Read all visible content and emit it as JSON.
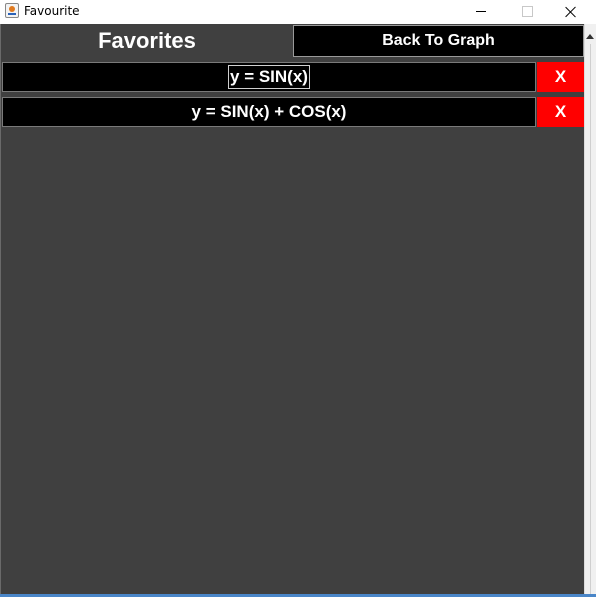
{
  "window": {
    "title": "Favourite",
    "icon": "java-icon"
  },
  "header": {
    "title": "Favorites",
    "back_button_label": "Back To Graph"
  },
  "favorites": [
    {
      "equation": "y = SIN(x)",
      "delete_label": "X"
    },
    {
      "equation": "y = SIN(x) + COS(x)",
      "delete_label": "X"
    }
  ],
  "colors": {
    "panel_background": "#404040",
    "row_background": "#000000",
    "delete_button": "#ff0000",
    "text": "#ffffff"
  }
}
